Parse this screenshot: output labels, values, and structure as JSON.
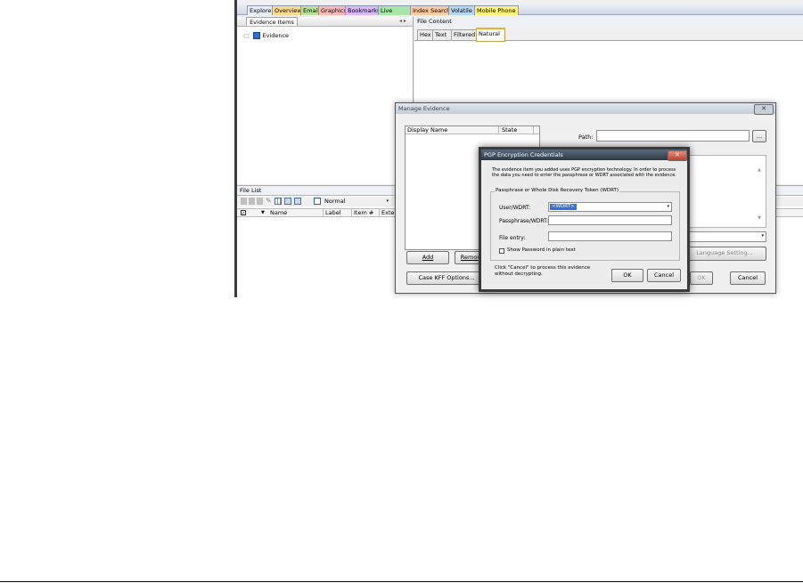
{
  "main_tabs": [
    {
      "label": "Explore",
      "bg": "#e6ecf8"
    },
    {
      "label": "Overview",
      "bg": "#ffd98f"
    },
    {
      "label": "Email",
      "bg": "#b9e39a"
    },
    {
      "label": "Graphics",
      "bg": "#ffb7b7"
    },
    {
      "label": "Bookmarks",
      "bg": "#d7b7f5"
    },
    {
      "label": "Live Search",
      "bg": "#a8e6a8"
    },
    {
      "label": "Index Search",
      "bg": "#ffc9a0"
    },
    {
      "label": "Volatile",
      "bg": "#b5d6f5"
    },
    {
      "label": "Mobile Phone",
      "bg": "#fff27a"
    }
  ],
  "evidence_pane": {
    "tab": "Evidence Items",
    "tree_root": "Evidence"
  },
  "file_content": {
    "title": "File Content",
    "tabs": [
      "Hex",
      "Text",
      "Filtered",
      "Natural"
    ]
  },
  "file_list": {
    "title": "File List",
    "view_mode": "Normal",
    "columns": [
      "Name",
      "Label",
      "Item #",
      "Exten"
    ]
  },
  "manage_dialog": {
    "title": "Manage Evidence",
    "columns": [
      "Display Name",
      "State"
    ],
    "path_label": "Path:",
    "browse": "...",
    "add": "Add",
    "remove": "Remove",
    "case_options": "Case KFF Options...",
    "language": "Language Setting...",
    "ok": "OK",
    "cancel": "Cancel"
  },
  "pgp_dialog": {
    "title": "PGP Encryption Credentials",
    "description": "The evidence item you added uses PGP encryption technology. In order to process the data you need to enter the passphrase or WDRT associated with the evidence.",
    "group_label": "Passphrase or Whole Disk Recovery Token (WDRT)",
    "user_label": "User/WDRT:",
    "user_value": "<WDRT>",
    "pass_label": "Passphrase/WDRT:",
    "file_label": "File entry:",
    "show_pw": "Show Password in plain text",
    "note": "Click \"Cancel\" to process this evidence without decrypting.",
    "ok": "OK",
    "cancel": "Cancel"
  }
}
